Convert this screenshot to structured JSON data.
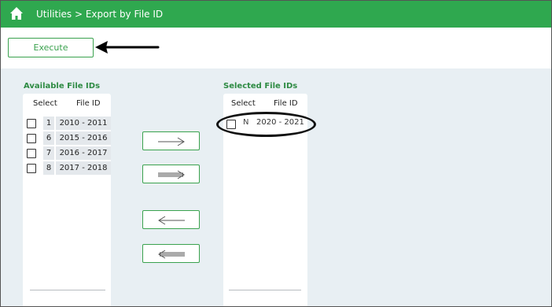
{
  "header": {
    "breadcrumb": "Utilities > Export by File ID",
    "home_icon": "home-icon",
    "bg_color": "#2fa84f"
  },
  "toolbar": {
    "execute_label": "Execute"
  },
  "available": {
    "title": "Available File IDs",
    "col_select": "Select",
    "col_file_id": "File ID",
    "rows": [
      {
        "num": "1",
        "file_id": "2010 - 2011"
      },
      {
        "num": "6",
        "file_id": "2015 - 2016"
      },
      {
        "num": "7",
        "file_id": "2016 - 2017"
      },
      {
        "num": "8",
        "file_id": "2017 - 2018"
      }
    ]
  },
  "selected": {
    "title": "Selected File IDs",
    "col_select": "Select",
    "col_file_id": "File ID",
    "rows": [
      {
        "flag": "N",
        "file_id": "2020 - 2021"
      }
    ]
  },
  "move_buttons": [
    {
      "name": "move-right-button",
      "icon": "arrow-right-icon"
    },
    {
      "name": "move-all-right-button",
      "icon": "double-arrow-right-icon"
    },
    {
      "name": "move-left-button",
      "icon": "arrow-left-icon"
    },
    {
      "name": "move-all-left-button",
      "icon": "double-arrow-left-icon"
    }
  ],
  "accent_color": "#3aa24e"
}
